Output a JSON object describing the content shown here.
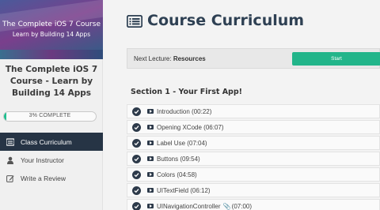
{
  "sidebar": {
    "thumbnail": {
      "line1": "The Complete iOS 7 Course",
      "line2": "Learn by Building 14 Apps"
    },
    "course_title": "The Complete iOS 7 Course - Learn by Building 14 Apps",
    "progress": {
      "fraction": 0.03,
      "label": "3% COMPLETE"
    },
    "nav": [
      {
        "label": "Class Curriculum",
        "icon": "list-icon",
        "active": true
      },
      {
        "label": "Your Instructor",
        "icon": "user-icon",
        "active": false
      },
      {
        "label": "Write a Review",
        "icon": "edit-icon",
        "active": false
      }
    ]
  },
  "main": {
    "title": "Course Curriculum",
    "title_icon": "list-alt-icon",
    "next_lecture": {
      "prefix": "Next Lecture: ",
      "name": "Resources"
    },
    "start_button": "Start",
    "section_title": "Section 1 - Your First App!",
    "lectures": [
      {
        "title": "Introduction (00:22)",
        "attachment": false,
        "duration": ""
      },
      {
        "title": "Opening XCode (06:07)",
        "attachment": false,
        "duration": ""
      },
      {
        "title": "Label Use (07:04)",
        "attachment": false,
        "duration": ""
      },
      {
        "title": "Buttons (09:54)",
        "attachment": false,
        "duration": ""
      },
      {
        "title": "Colors (04:58)",
        "attachment": false,
        "duration": ""
      },
      {
        "title": "UITextField (06:12)",
        "attachment": false,
        "duration": ""
      },
      {
        "title": "UINavigationController",
        "attachment": true,
        "duration": "(07:00)"
      }
    ]
  },
  "colors": {
    "accent_green": "#22b58a",
    "nav_active": "#263445",
    "title_color": "#2e4053"
  }
}
